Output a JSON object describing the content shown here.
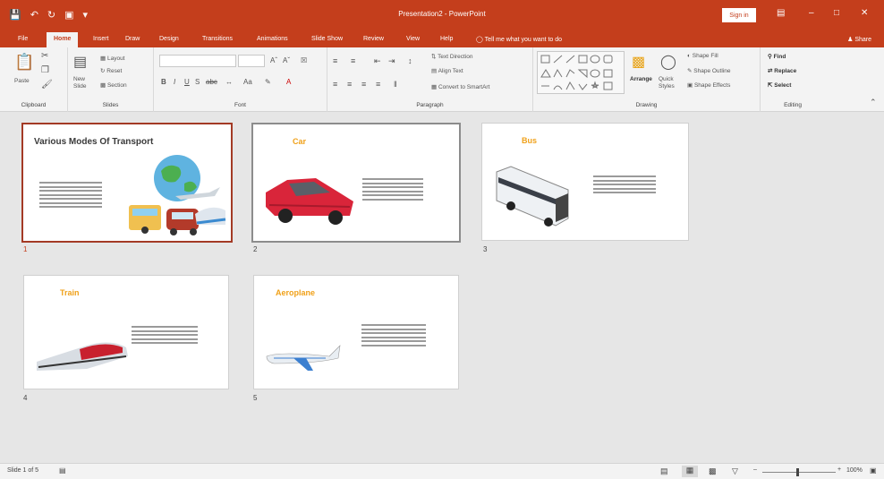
{
  "titlebar": {
    "title": "Presentation2 - PowerPoint",
    "signin_label": "Sign in"
  },
  "tabs": [
    "File",
    "Home",
    "Insert",
    "Draw",
    "Design",
    "Transitions",
    "Animations",
    "Slide Show",
    "Review",
    "View",
    "Help"
  ],
  "tell_me": "Tell me what you want to do",
  "share_label": "Share",
  "ribbon": {
    "clipboard": {
      "label": "Clipboard",
      "paste": "Paste"
    },
    "slides": {
      "label": "Slides",
      "new_slide": "New Slide",
      "layout": "Layout",
      "reset": "Reset",
      "section": "Section"
    },
    "font": {
      "label": "Font"
    },
    "paragraph": {
      "label": "Paragraph",
      "text_direction": "Text Direction",
      "align_text": "Align Text",
      "convert_smartart": "Convert to SmartArt"
    },
    "drawing": {
      "label": "Drawing",
      "arrange": "Arrange",
      "quick_styles": "Quick Styles",
      "shape_fill": "Shape Fill",
      "shape_outline": "Shape Outline",
      "shape_effects": "Shape Effects"
    },
    "editing": {
      "label": "Editing",
      "find": "Find",
      "replace": "Replace",
      "select": "Select"
    }
  },
  "slides": [
    {
      "num": "1",
      "title": "Various Modes Of Transport"
    },
    {
      "num": "2",
      "title": "Car"
    },
    {
      "num": "3",
      "title": "Bus"
    },
    {
      "num": "4",
      "title": "Train"
    },
    {
      "num": "5",
      "title": "Aeroplane"
    }
  ],
  "status": {
    "slide_count": "Slide 1 of 5",
    "zoom": "100%"
  },
  "colors": {
    "accent": "#c43e1c",
    "title_orange": "#f0a11a"
  }
}
